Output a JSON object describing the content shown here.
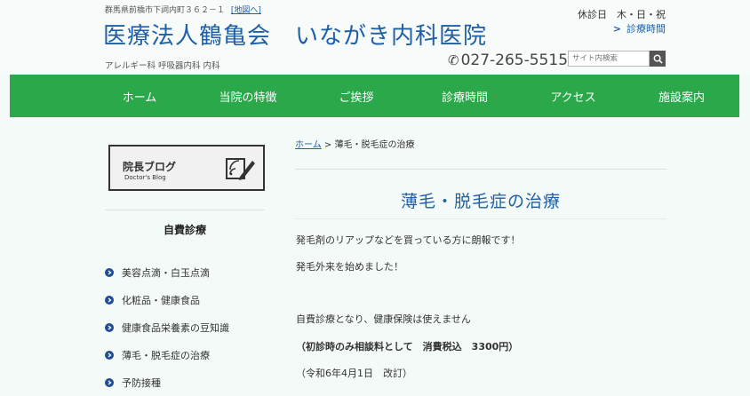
{
  "header": {
    "address": "群馬県前橋市下詞内町３６２－１",
    "map_link": "[地図へ]",
    "title": "医療法人鶴亀会　いながき内科医院",
    "departments": "アレルギー科 呼吸器内科 内科",
    "holiday": "休診日　木・日・祝",
    "hours_link": "診療時間",
    "phone": "027-265-5515",
    "search_placeholder": "サイト内検索"
  },
  "nav": [
    "ホーム",
    "当院の特徴",
    "ご挨拶",
    "診療時間",
    "アクセス",
    "施設案内"
  ],
  "sidebar": {
    "blog_title": "院長ブログ",
    "blog_subtitle": "Doctor's Blog",
    "heading": "自費診療",
    "items": [
      "美容点滴・白玉点滴",
      "化粧品・健康食品",
      "健康食品栄養素の豆知識",
      "薄毛・脱毛症の治療",
      "予防接種"
    ]
  },
  "breadcrumb": {
    "home": "ホーム",
    "sep": " > ",
    "current": "薄毛・脱毛症の治療"
  },
  "main": {
    "title": "薄毛・脱毛症の治療",
    "p1": "発毛剤のリアップなどを買っている方に朗報です！",
    "p2": "発毛外来を始めました！",
    "p3": "自費診療となり、健康保険は使えません",
    "p4": "（初診時のみ相談料として　消費税込　3300円）",
    "p5": "（令和6年4月1日　改訂）"
  },
  "colors": {
    "nav_bg": "#2aa84a",
    "title_blue": "#1f5fa8",
    "bullet": "#1f4e96"
  }
}
